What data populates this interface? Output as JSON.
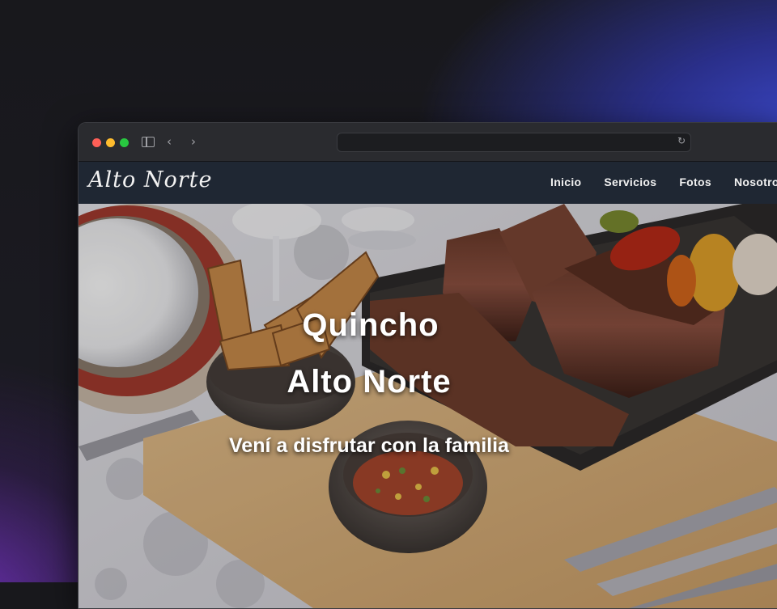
{
  "browser": {
    "url": ""
  },
  "site": {
    "brand": "Alto Norte",
    "nav": [
      {
        "label": "Inicio"
      },
      {
        "label": "Servicios"
      },
      {
        "label": "Fotos"
      },
      {
        "label": "Nosotros"
      }
    ]
  },
  "hero": {
    "title_line1": "Quincho",
    "title_line2": "Alto Norte",
    "subtitle": "Vení a disfrutar con la familia"
  },
  "colors": {
    "navbar_bg": "#1f2733",
    "titlebar_bg": "#2a2b2f",
    "text": "#ffffff"
  },
  "icons": {
    "sidebar": "sidebar-icon",
    "back": "chevron-left-icon",
    "forward": "chevron-right-icon",
    "reload": "reload-icon"
  }
}
